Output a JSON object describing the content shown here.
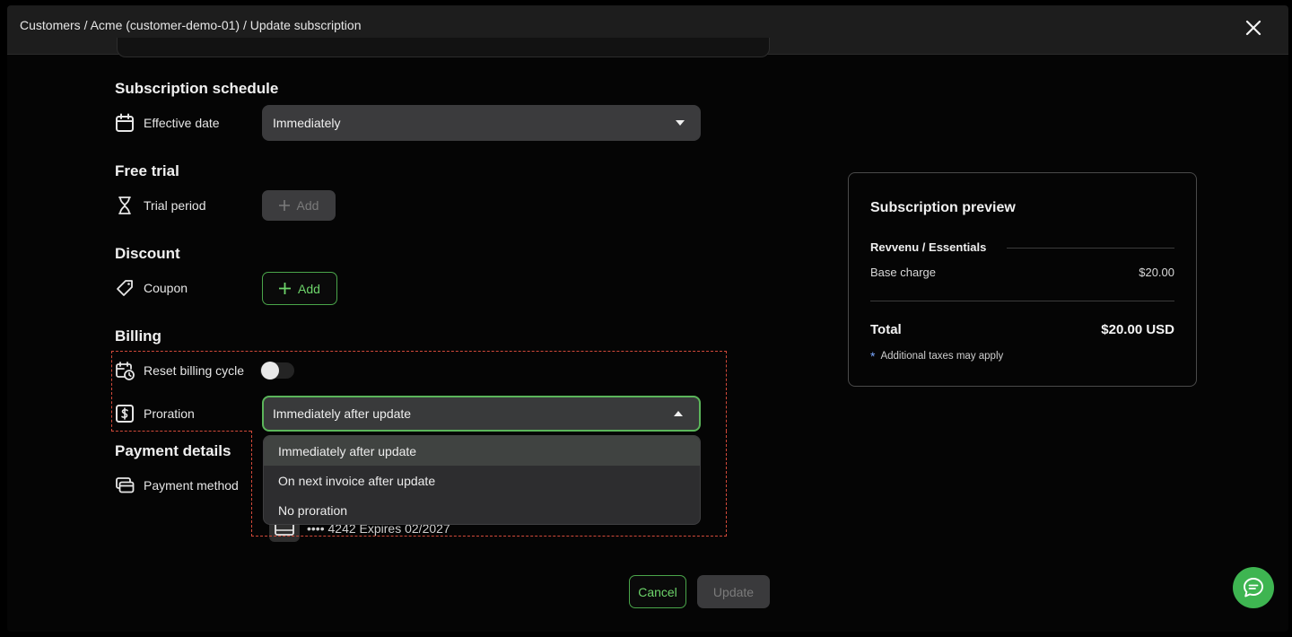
{
  "header": {
    "breadcrumb": "Customers / Acme (customer-demo-01) / Update subscription",
    "close_icon": "close-icon"
  },
  "schedule": {
    "title": "Subscription schedule",
    "effective_date_label": "Effective date",
    "effective_date_value": "Immediately"
  },
  "free_trial": {
    "title": "Free trial",
    "trial_period_label": "Trial period",
    "add_label": "Add"
  },
  "discount": {
    "title": "Discount",
    "coupon_label": "Coupon",
    "add_label": "Add"
  },
  "billing": {
    "title": "Billing",
    "reset_billing_cycle_label": "Reset billing cycle",
    "reset_billing_cycle_on": false,
    "proration_label": "Proration",
    "proration_value": "Immediately after update",
    "proration_options": [
      "Immediately after update",
      "On next invoice after update",
      "No proration"
    ]
  },
  "payment": {
    "title": "Payment details",
    "method_label": "Payment method",
    "card_text": "•••• 4242  Expires 02/2027"
  },
  "preview": {
    "title": "Subscription preview",
    "plan": "Revvenu / Essentials",
    "base_charge_label": "Base charge",
    "base_charge_value": "$20.00",
    "total_label": "Total",
    "total_value": "$20.00 USD",
    "note_marker": "*",
    "note": "Additional taxes may apply"
  },
  "footer": {
    "cancel_label": "Cancel",
    "update_label": "Update"
  },
  "colors": {
    "accent": "#5bb55a",
    "fab": "#3eb551",
    "annotation": "#d24a3a"
  }
}
